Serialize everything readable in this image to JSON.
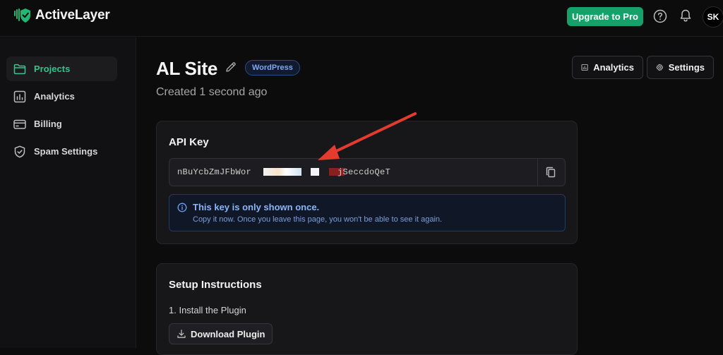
{
  "header": {
    "app_name": "ActiveLayer",
    "upgrade_label": "Upgrade to Pro",
    "avatar_initials": "SK",
    "brand_color": "#16a06a"
  },
  "sidebar": {
    "items": [
      {
        "label": "Projects",
        "icon": "folder-icon",
        "active": true
      },
      {
        "label": "Analytics",
        "icon": "bar-chart-icon",
        "active": false
      },
      {
        "label": "Billing",
        "icon": "credit-card-icon",
        "active": false
      },
      {
        "label": "Spam Settings",
        "icon": "shield-check-icon",
        "active": false
      }
    ]
  },
  "project": {
    "title": "AL Site",
    "platform": "WordPress",
    "created": "Created 1 second ago",
    "analytics_label": "Analytics",
    "settings_label": "Settings"
  },
  "api_key": {
    "heading": "API Key",
    "value_start": "nBuYcbZmJFbWor",
    "value_end": "jSeccdoQeT",
    "notice_title": "This key is only shown once.",
    "notice_body": "Copy it now. Once you leave this page, you won't be able to see it again."
  },
  "setup": {
    "heading": "Setup Instructions",
    "step1": "1. Install the Plugin",
    "download_label": "Download Plugin"
  },
  "annotation": {
    "arrow_color": "#e53b2f"
  }
}
